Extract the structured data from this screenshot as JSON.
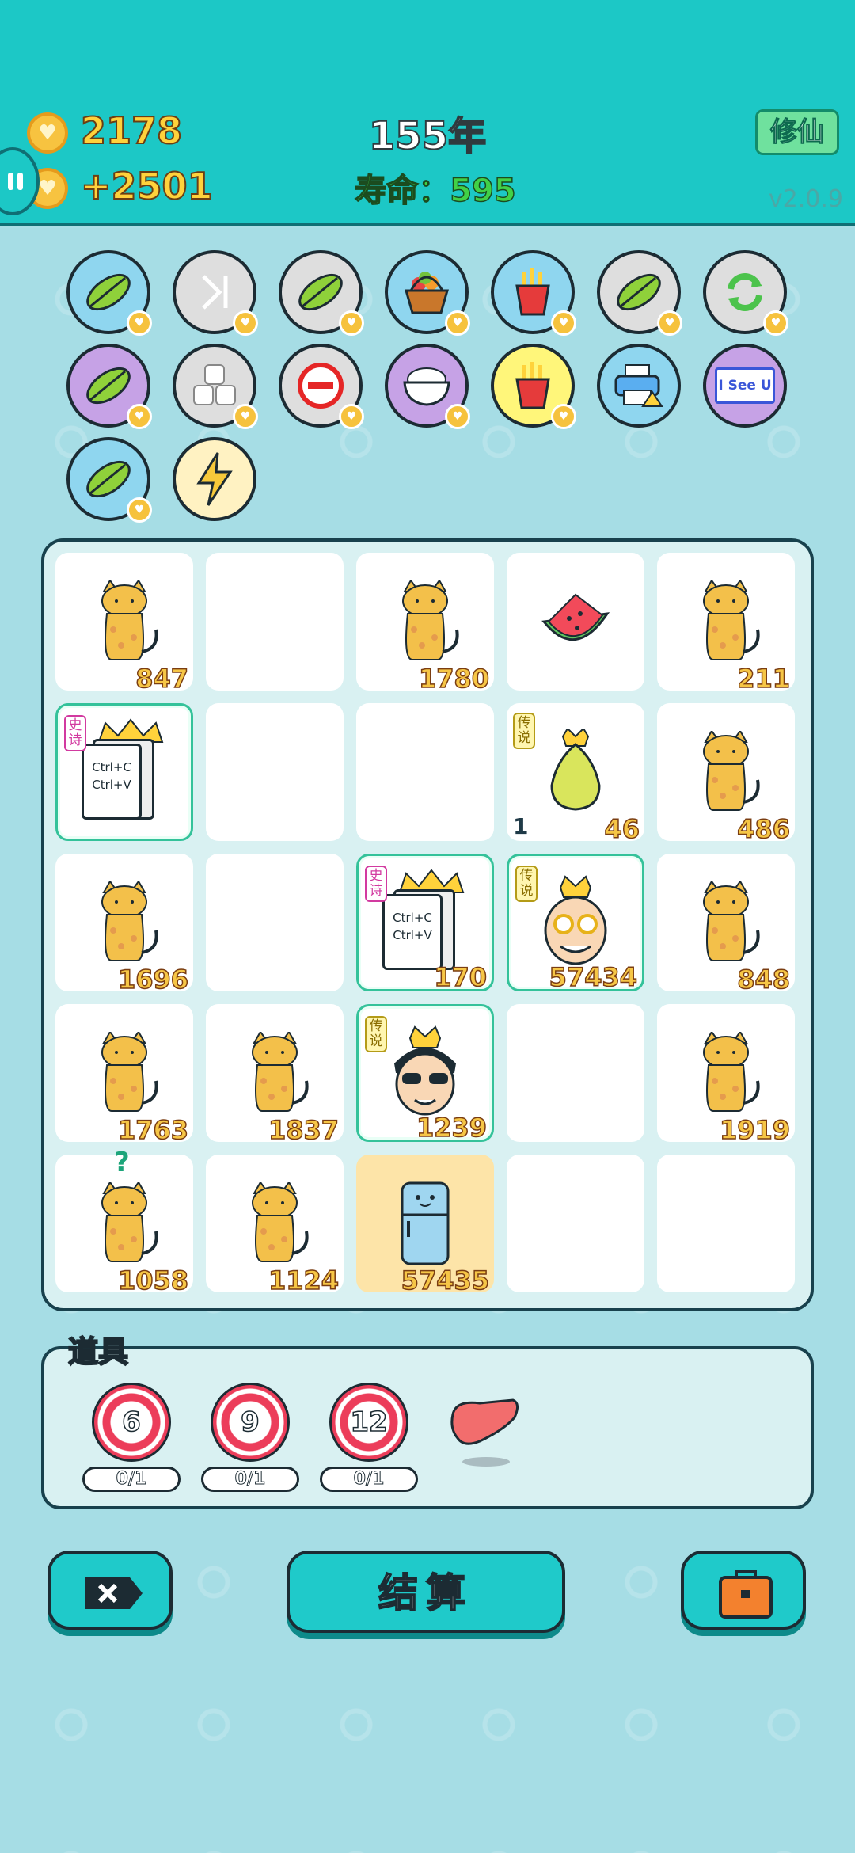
{
  "header": {
    "coins": "2178",
    "income": "+2501",
    "year": "155年",
    "lifespan_label": "寿命：",
    "lifespan_value": "595",
    "cultivate_button": "修仙",
    "version": "v2.0.9"
  },
  "skills": {
    "row1": [
      "leaf-icon",
      "skip-icon",
      "leaf-icon",
      "fruit-basket-icon",
      "fries-icon",
      "leaf-icon",
      "refresh-icon"
    ],
    "row2": [
      "leaf-icon",
      "cubes-icon",
      "minus-circle-icon",
      "rice-bowl-icon",
      "fries-icon",
      "printer-icon",
      "i-see-u-icon"
    ],
    "row3": [
      "leaf-icon",
      "lightning-icon"
    ],
    "i_see_u_text": "I See U"
  },
  "board": {
    "cells": [
      {
        "item": "cat",
        "count": "847"
      },
      {
        "item": "empty",
        "count": ""
      },
      {
        "item": "cat",
        "count": "1780"
      },
      {
        "item": "watermelon",
        "count": ""
      },
      {
        "item": "cat",
        "count": "211"
      },
      {
        "item": "copy-paste",
        "count": "",
        "tag": "史诗",
        "selected": true,
        "lines": [
          "Ctrl+C",
          "Ctrl+V"
        ]
      },
      {
        "item": "empty",
        "count": ""
      },
      {
        "item": "empty",
        "count": ""
      },
      {
        "item": "pear",
        "count": "46",
        "tag": "传说",
        "side": "1"
      },
      {
        "item": "cat",
        "count": "486"
      },
      {
        "item": "cat",
        "count": "1696"
      },
      {
        "item": "empty",
        "count": ""
      },
      {
        "item": "copy-paste",
        "count": "170",
        "tag": "史诗",
        "selected": true,
        "lines": [
          "Ctrl+C",
          "Ctrl+V"
        ]
      },
      {
        "item": "old-man",
        "count": "57434",
        "tag": "传说",
        "selected": true
      },
      {
        "item": "cat",
        "count": "848"
      },
      {
        "item": "cat",
        "count": "1763"
      },
      {
        "item": "cat",
        "count": "1837"
      },
      {
        "item": "sunglasses-man",
        "count": "1239",
        "tag": "传说",
        "selected": true
      },
      {
        "item": "empty",
        "count": ""
      },
      {
        "item": "cat",
        "count": "1919"
      },
      {
        "item": "cat",
        "count": "1058",
        "mark": "?"
      },
      {
        "item": "cat",
        "count": "1124"
      },
      {
        "item": "fridge",
        "count": "57435",
        "highlight": true
      },
      {
        "item": "empty",
        "count": ""
      },
      {
        "item": "empty",
        "count": ""
      }
    ]
  },
  "tools": {
    "title": "道具",
    "items": [
      {
        "value": "6",
        "usage": "0/1"
      },
      {
        "value": "9",
        "usage": "0/1"
      },
      {
        "value": "12",
        "usage": "0/1"
      }
    ],
    "extra_icon": "liver-icon"
  },
  "bottom": {
    "settle_label": "结算"
  },
  "colors": {
    "header": "#1cc8c6",
    "accent": "#1fcaca",
    "gold": "#f6c646"
  }
}
